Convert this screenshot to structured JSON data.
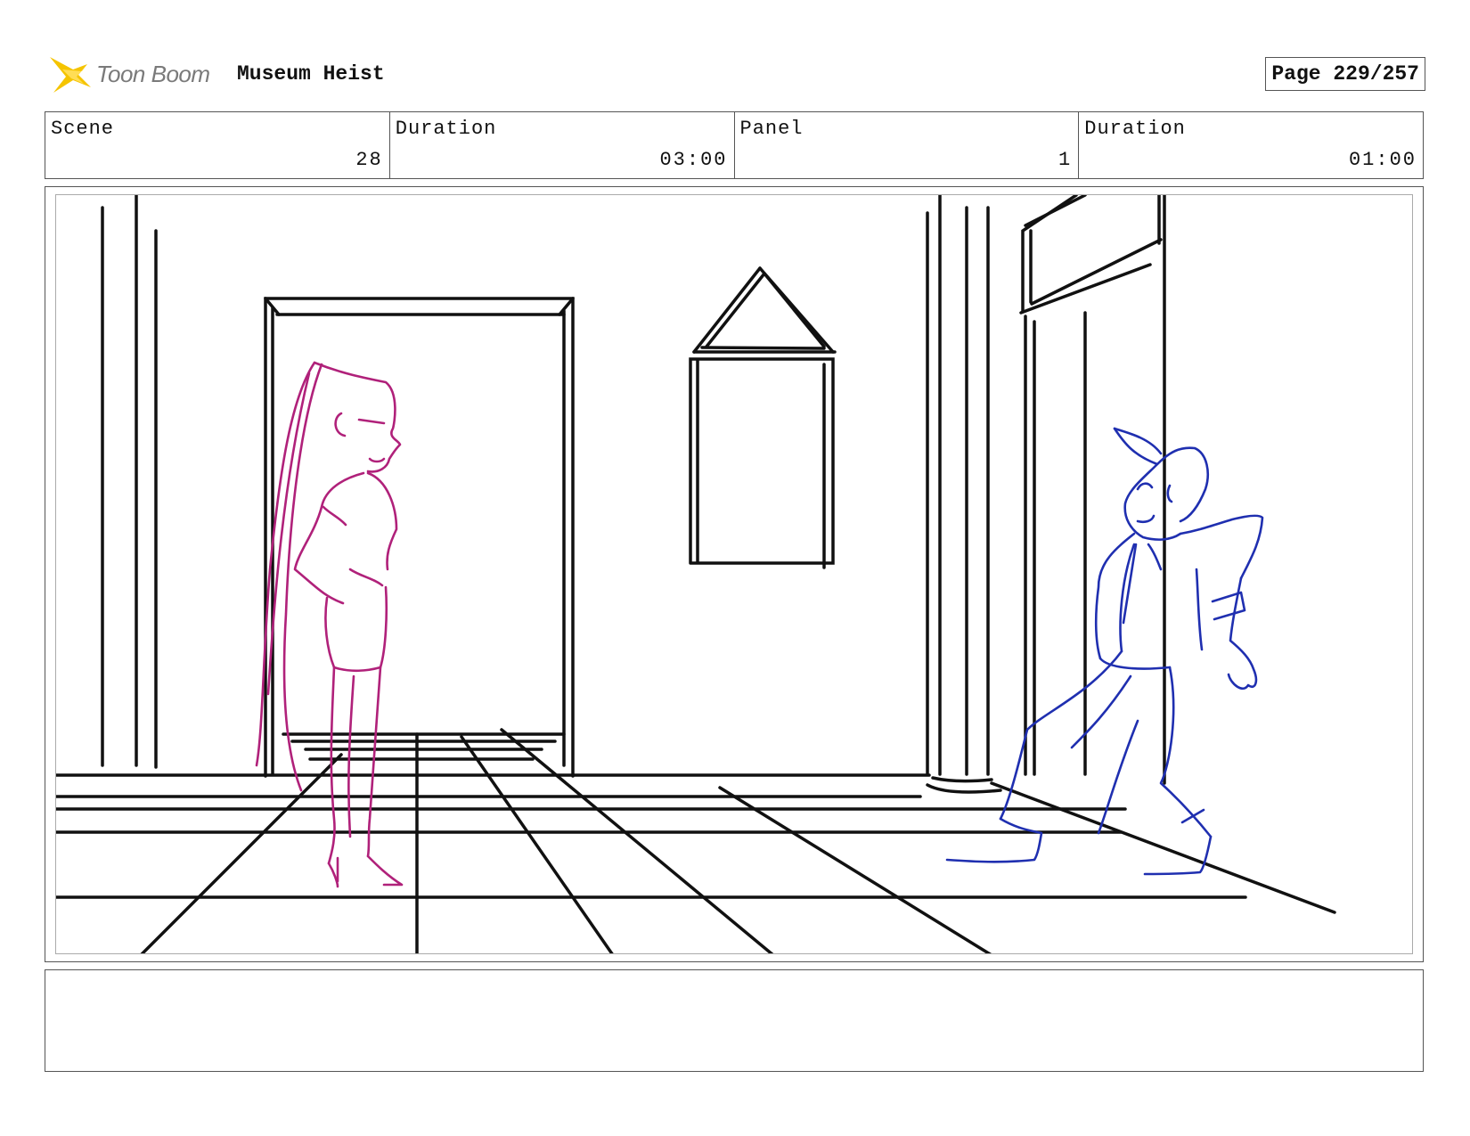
{
  "header": {
    "logo_text": "Toon Boom",
    "project_title": "Museum Heist",
    "page_label": "Page 229/257"
  },
  "info": {
    "scene_label": "Scene",
    "scene_value": "28",
    "scene_duration_label": "Duration",
    "scene_duration_value": "03:00",
    "panel_label": "Panel",
    "panel_value": "1",
    "panel_duration_label": "Duration",
    "panel_duration_value": "01:00"
  },
  "colors": {
    "logo_star": "#f5c400",
    "logo_text": "#7a7a7a",
    "sketch_background": "#111111",
    "character_left": "#b0217a",
    "character_right": "#1f2fb0"
  },
  "notes": ""
}
